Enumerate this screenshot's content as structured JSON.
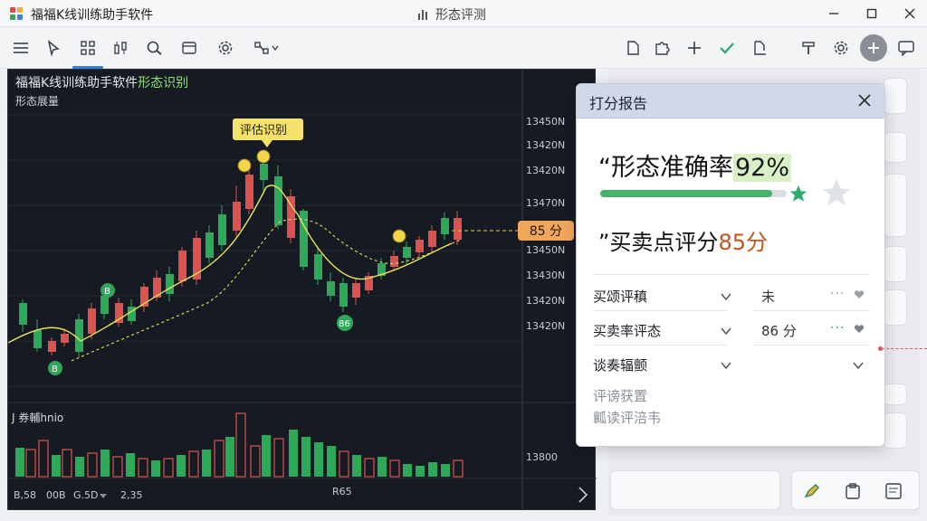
{
  "app": {
    "title": "福福K线训练助手软件",
    "center_title": "形态评测"
  },
  "chart": {
    "title_main": "福福K线训练助手软件",
    "title_highlight": "形态识别",
    "subtitle": "形态展量",
    "callout": "评估识别",
    "price_labels": [
      "13450N",
      "13420N",
      "13420N",
      "13470N",
      "13420N",
      "13450N",
      "13430N",
      "13420N",
      "13420N"
    ],
    "volume_label": "J 券輔hnio",
    "volume_axis": "13800",
    "bottom_left": [
      "B,58",
      "00B",
      "G.5D",
      "2,35"
    ],
    "bottom_center": "R65",
    "markers": [
      "B",
      "B",
      "86"
    ],
    "price_tag": "85 分",
    "colors": {
      "up": "#d9534f",
      "down": "#2ea95a",
      "ma": "#e6e35a",
      "bg": "#161a22"
    }
  },
  "dialog": {
    "title": "打分报告",
    "metric1_label": "“形态准确率",
    "metric1_value": "92%",
    "accuracy_progress": 0.92,
    "metric2_label": "”买卖点评分",
    "metric2_value": "85分",
    "rows": [
      {
        "label": "买颂评稹",
        "value": "未"
      },
      {
        "label": "买卖率评态",
        "value": "86 分"
      },
      {
        "label": "谈奏辐颤",
        "value": ""
      }
    ],
    "links": [
      "评谤获置",
      "瓤读评涪韦"
    ],
    "dots": "···"
  }
}
